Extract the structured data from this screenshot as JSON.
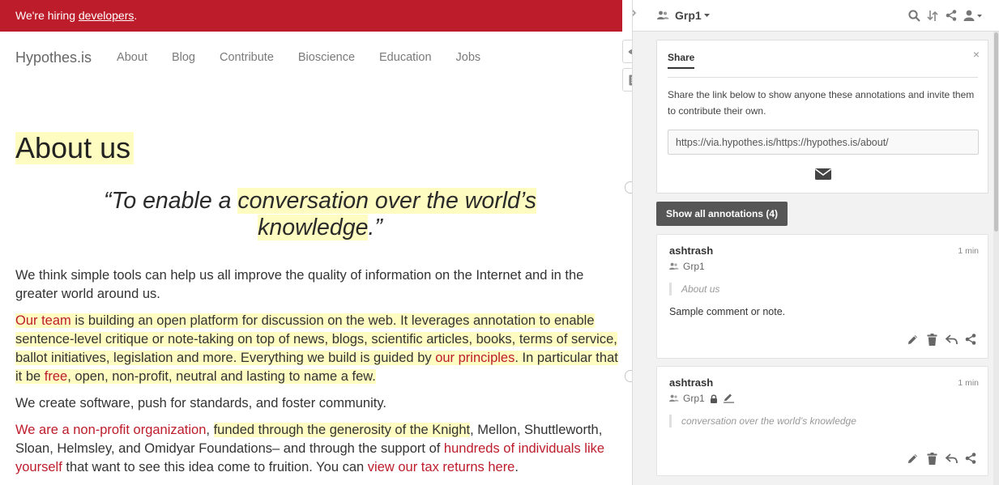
{
  "banner": {
    "text": "We're hiring ",
    "link": "developers",
    "suffix": "."
  },
  "site": {
    "logo": "Hypothes.is",
    "nav": [
      "About",
      "Blog",
      "Contribute",
      "Bioscience",
      "Education",
      "Jobs"
    ]
  },
  "article": {
    "title": "About us",
    "quote_open": "“To enable a ",
    "quote_highlight_1": "conversation over the world’s",
    "quote_highlight_2": "knowledge",
    "quote_close": ".”",
    "p1": "We think simple tools can help us all improve the quality of information on the Internet and in the greater world around us.",
    "p2": {
      "link1": "Our team",
      "text1": " is building an open platform for discussion on the web. It leverages annotation to enable sentence-level critique or note-taking on top of news, blogs, scientific articles, books, terms of service, ballot initiatives, legislation and more. Everything we build is guided by ",
      "link2": "our principles",
      "text2": ". In particular that it be ",
      "link3": "free",
      "text3": ", open, non-profit, neutral and lasting to name a few."
    },
    "p3": "We create software, push for standards, and foster community.",
    "p4": {
      "link1": "We are a non-profit organization",
      "text1": ", ",
      "hl": "funded through the generosity of the Knight",
      "text2": ", Mellon, Shuttleworth, Sloan, Helmsley, and Omidyar Foundations– and through the support of ",
      "link2": "hundreds of individuals like yourself",
      "text3": " that want to see this idea come to fruition. You can ",
      "link3": "view our tax returns here",
      "text4": "."
    }
  },
  "buckets": [
    "2",
    "2"
  ],
  "sidebar": {
    "group_name": "Grp1",
    "share": {
      "tab_label": "Share",
      "close": "×",
      "description": "Share the link below to show anyone these annotations and invite them to contribute their own.",
      "link": "https://via.hypothes.is/https://hypothes.is/about/"
    },
    "show_all_label": "Show all annotations (4)",
    "annotations": [
      {
        "user": "ashtrash",
        "time": "1 min",
        "group": "Grp1",
        "quote": "About us",
        "note": "Sample comment or note."
      },
      {
        "user": "ashtrash",
        "time": "1 min",
        "group": "Grp1",
        "quote": "conversation over the world’s knowledge",
        "note": ""
      }
    ]
  },
  "colors": {
    "brand_red": "#bd1c2b",
    "highlight": "#fefcc1",
    "sidebar_bg": "#f2f2f2"
  },
  "icons": [
    "chevron-right-icon",
    "group-icon",
    "search-icon",
    "sort-icon",
    "share-icon",
    "user-icon",
    "eye-icon",
    "notes-icon",
    "email-icon",
    "lock-icon",
    "pencil-icon",
    "edit-icon",
    "delete-icon",
    "reply-icon"
  ]
}
